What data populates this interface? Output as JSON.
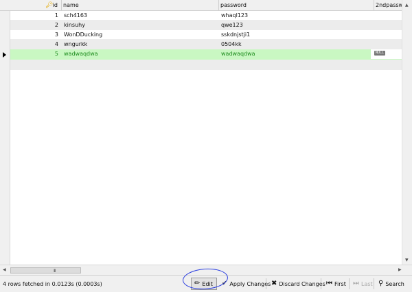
{
  "grid": {
    "columns": {
      "id": "id",
      "name": "name",
      "password": "password",
      "second_password": "2ndpasswo"
    },
    "rows": [
      {
        "id": "1",
        "name": "sch4163",
        "password": "whaql123"
      },
      {
        "id": "2",
        "name": "kinsuhy",
        "password": "qwe123"
      },
      {
        "id": "3",
        "name": "WonDDucking",
        "password": "sskdnjstji1"
      },
      {
        "id": "4",
        "name": "wngurkk",
        "password": "0504kk"
      },
      {
        "id": "5",
        "name": "wadwaqdwa",
        "password": "wadwaqdwa",
        "second_password": "NULL"
      }
    ]
  },
  "hscroll": {
    "grip": "III"
  },
  "status": {
    "text": "4 rows fetched in 0.0123s (0.0003s)"
  },
  "toolbar": {
    "edit": "Edit",
    "apply": "Apply Changes",
    "discard": "Discard Changes",
    "first": "First",
    "last": "Last",
    "search": "Search"
  },
  "colors": {
    "selected_row": "#c9f7c2",
    "selected_text": "#1a8a1a",
    "annotation": "#2d40e0"
  }
}
